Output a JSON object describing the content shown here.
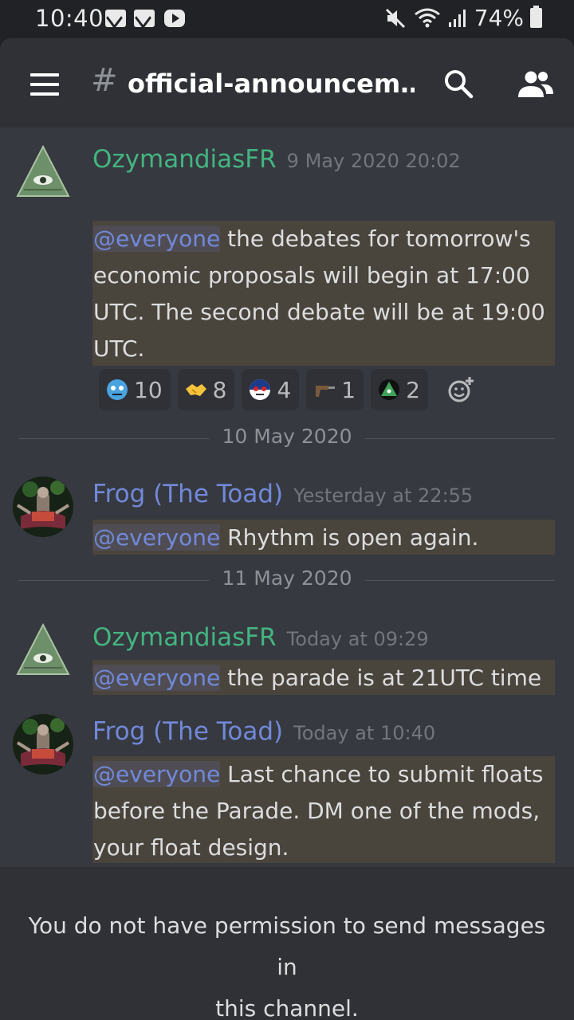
{
  "status_bar": {
    "time": "10:40",
    "notification_icons": [
      "mail-icon",
      "mail-icon",
      "youtube-icon"
    ],
    "battery": "74%"
  },
  "header": {
    "hash": "#",
    "channel_name": "official-announcem…"
  },
  "messages": [
    {
      "author": "OzymandiasFR",
      "author_color": "#43b581",
      "timestamp": "9 May 2020 20:02",
      "mention": "@everyone",
      "lines": [
        " the debates for tomorrow's",
        "economic proposals will begin at 17:00",
        "UTC. The second debate will be at 19:00",
        "UTC."
      ],
      "reactions": [
        {
          "emoji": "blue-face-emoji",
          "count": "10"
        },
        {
          "emoji": "handshake-emoji",
          "count": "8"
        },
        {
          "emoji": "flag-face-emoji",
          "count": "4"
        },
        {
          "emoji": "revolver-emoji",
          "count": "1"
        },
        {
          "emoji": "pyramid-emoji",
          "count": "2"
        }
      ]
    },
    {
      "author": "Frog (The Toad)",
      "author_color": "#7289da",
      "timestamp": "Yesterday at 22:55",
      "mention": "@everyone",
      "lines": [
        " Rhythm is open again."
      ]
    },
    {
      "author": "OzymandiasFR",
      "author_color": "#43b581",
      "timestamp": "Today at 09:29",
      "mention": "@everyone",
      "lines": [
        " the parade is at 21UTC time"
      ]
    },
    {
      "author": "Frog (The Toad)",
      "author_color": "#7289da",
      "timestamp": "Today at 10:40",
      "mention": "@everyone",
      "lines": [
        " Last chance to submit floats",
        "before the Parade. DM one of the mods,",
        "your float design."
      ]
    }
  ],
  "dividers": [
    "10 May 2020",
    "11 May 2020"
  ],
  "footer": {
    "notice_line1": "You do not have permission to send messages in",
    "notice_line2": "this channel."
  }
}
